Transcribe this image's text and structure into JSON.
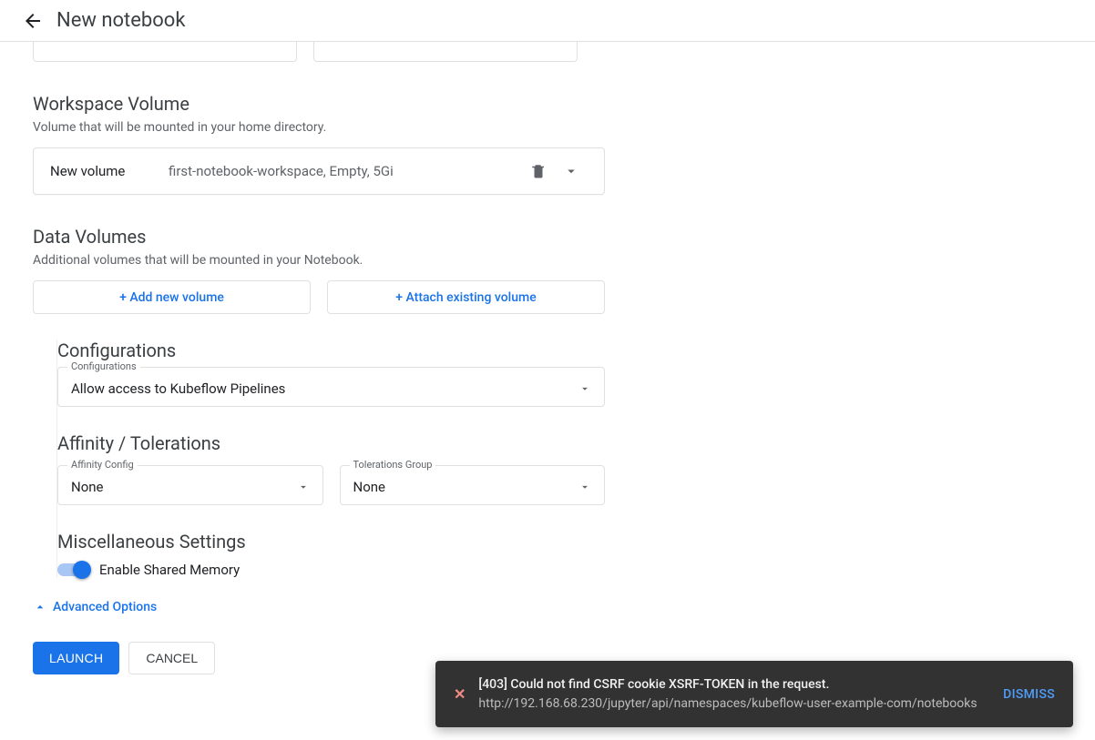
{
  "header": {
    "title": "New notebook"
  },
  "workspace": {
    "title": "Workspace Volume",
    "subtitle": "Volume that will be mounted in your home directory.",
    "newVolumeLabel": "New volume",
    "volumeDesc": "first-notebook-workspace, Empty, 5Gi"
  },
  "dataVolumes": {
    "title": "Data Volumes",
    "subtitle": "Additional volumes that will be mounted in your Notebook.",
    "addBtn": "+ Add new volume",
    "attachBtn": "+ Attach existing volume"
  },
  "configurations": {
    "title": "Configurations",
    "fieldLabel": "Configurations",
    "value": "Allow access to Kubeflow Pipelines"
  },
  "affinity": {
    "title": "Affinity / Tolerations",
    "affinityLabel": "Affinity Config",
    "affinityValue": "None",
    "tolerLabel": "Tolerations Group",
    "tolerValue": "None"
  },
  "misc": {
    "title": "Miscellaneous Settings",
    "sharedMem": "Enable Shared Memory"
  },
  "advanced": "Advanced Options",
  "footer": {
    "launch": "LAUNCH",
    "cancel": "CANCEL"
  },
  "snackbar": {
    "line1": "[403] Could not find CSRF cookie XSRF-TOKEN in the request.",
    "line2": "http://192.168.68.230/jupyter/api/namespaces/kubeflow-user-example-com/notebooks",
    "dismiss": "DISMISS"
  }
}
